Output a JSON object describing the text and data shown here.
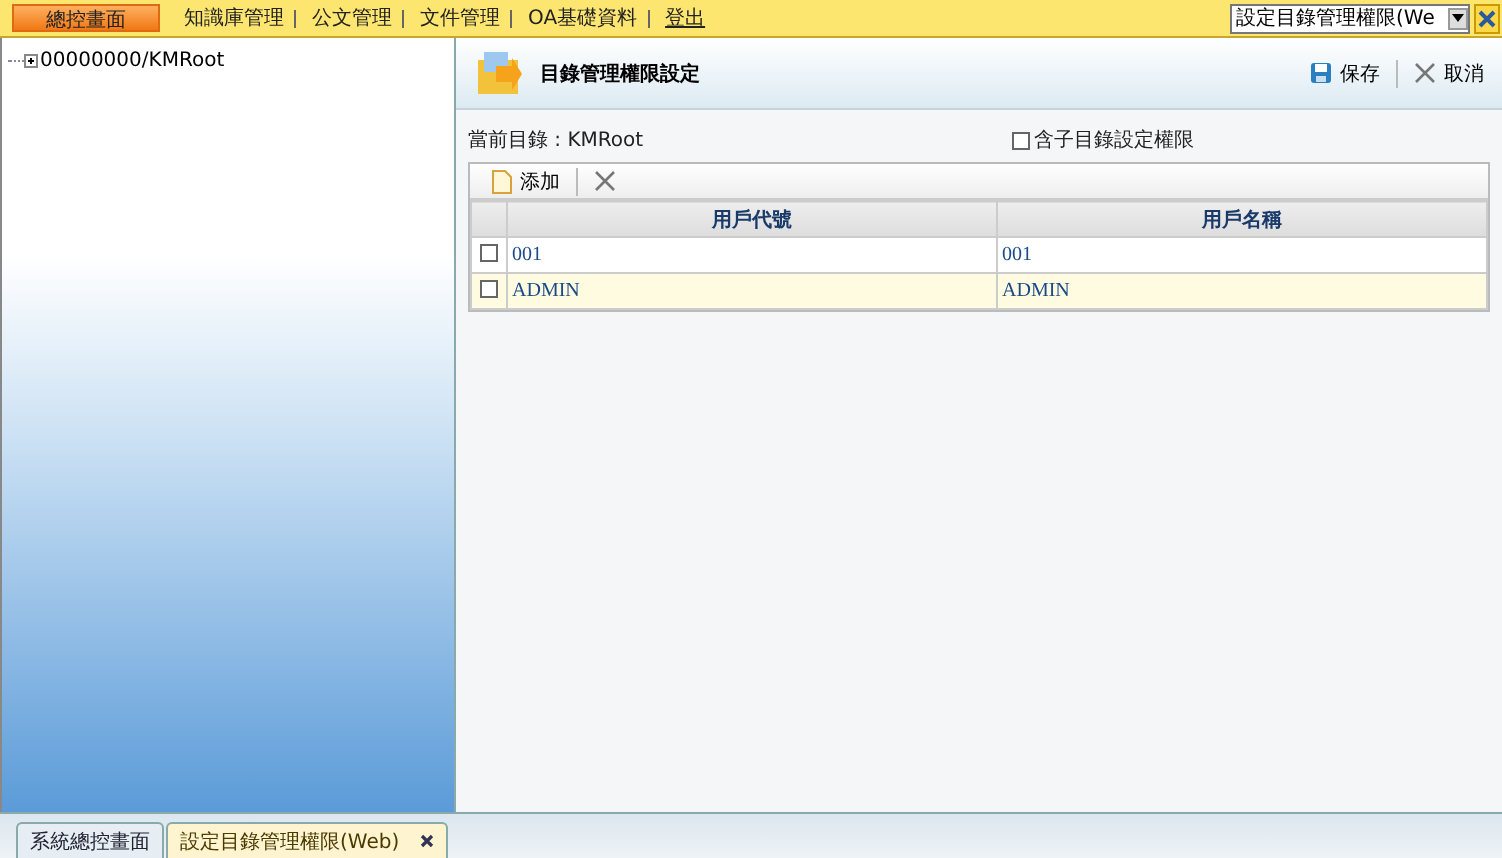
{
  "top_menu": [
    {
      "label": "總控畫面",
      "kind": "primary"
    },
    {
      "label": "知識庫管理",
      "kind": "link"
    },
    {
      "label": "公文管理",
      "kind": "link"
    },
    {
      "label": "文件管理",
      "kind": "link"
    },
    {
      "label": "OA基礎資料",
      "kind": "link"
    },
    {
      "label": "登出",
      "kind": "logout"
    }
  ],
  "window_select": {
    "value": "設定目錄管理權限(We"
  },
  "tree": [
    {
      "label": "00000000/KMRoot",
      "expanded": false
    }
  ],
  "panel": {
    "title": "目錄管理權限設定",
    "actions": [
      {
        "label": "保存",
        "kind": "save"
      },
      {
        "label": "取消",
        "kind": "cancel"
      }
    ]
  },
  "current_dir": {
    "label": "當前目錄 : KMRoot"
  },
  "include_sub": {
    "label": "含子目錄設定權限",
    "checked": false
  },
  "grid_toolbar": [
    {
      "label": "添加",
      "kind": "add"
    },
    {
      "kind": "delete"
    }
  ],
  "table": {
    "columns": [
      "用戶代號",
      "用戶名稱"
    ],
    "rows": [
      {
        "checked": false,
        "selected": false,
        "cells": [
          "001",
          "001"
        ]
      },
      {
        "checked": false,
        "selected": true,
        "cells": [
          "ADMIN",
          "ADMIN"
        ]
      }
    ]
  },
  "bottom_tabs": [
    {
      "label": "系統總控畫面",
      "selected": false,
      "closable": false
    },
    {
      "label": "設定目錄管理權限(Web)",
      "selected": true,
      "closable": true
    }
  ]
}
